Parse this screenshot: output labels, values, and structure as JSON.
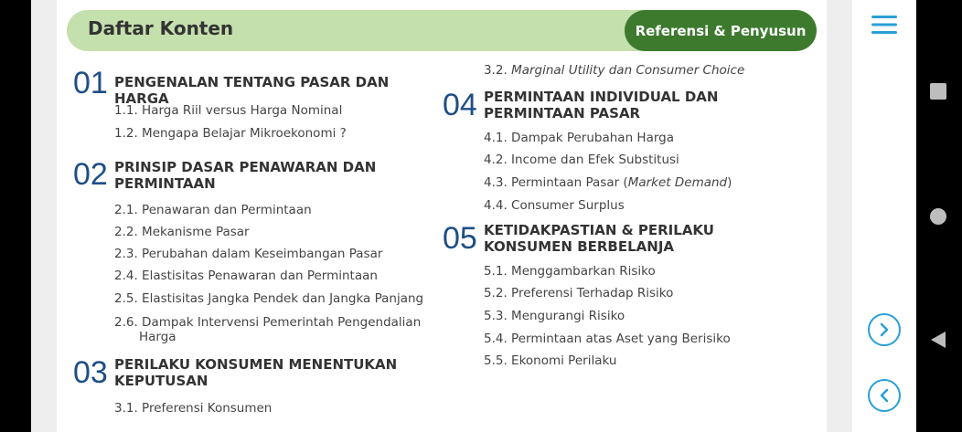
{
  "header": {
    "title": "Daftar Konten",
    "ref_button": "Referensi & Penyusun"
  },
  "chapters": [
    {
      "num": "01",
      "title": "PENGENALAN TENTANG PASAR DAN HARGA",
      "items": [
        "1.1. Harga Riil versus Harga Nominal",
        "1.2. Mengapa Belajar Mikroekonomi ?"
      ]
    },
    {
      "num": "02",
      "title": "PRINSIP DASAR PENAWARAN DAN PERMINTAAN",
      "items": [
        "2.1. Penawaran dan Permintaan",
        "2.2. Mekanisme Pasar",
        "2.3. Perubahan dalam Keseimbangan Pasar",
        "2.4. Elastisitas Penawaran dan Permintaan",
        "2.5. Elastisitas Jangka Pendek dan Jangka Panjang",
        "2.6. Dampak Intervensi Pemerintah Pengendalian Harga"
      ]
    },
    {
      "num": "03",
      "title": "PERILAKU KONSUMEN MENENTUKAN KEPUTUSAN",
      "items": [
        "3.1. Preferensi Konsumen",
        "3.2. Marginal Utility dan Consumer Choice"
      ]
    },
    {
      "num": "04",
      "title": "PERMINTAAN INDIVIDUAL DAN PERMINTAAN PASAR",
      "items": [
        "4.1. Dampak Perubahan Harga",
        "4.2. Income dan Efek Substitusi",
        "4.3. Permintaan Pasar (Market Demand)",
        "4.4. Consumer Surplus"
      ]
    },
    {
      "num": "05",
      "title": "KETIDAKPASTIAN & PERILAKU KONSUMEN BERBELANJA",
      "items": [
        "5.1. Menggambarkan Risiko",
        "5.2. Preferensi Terhadap Risiko",
        "5.3. Mengurangi Risiko",
        "5.4. Permintaan atas Aset yang Berisiko",
        "5.5. Ekonomi Perilaku"
      ]
    }
  ],
  "sub_parts": {
    "marginal_prefix": "3.2. ",
    "marginal_italic": "Marginal Utility dan Consumer Choice",
    "market_prefix": "4.3. Permintaan Pasar (",
    "market_italic": "Market Demand",
    "market_suffix": ")"
  },
  "icons": {
    "menu": "hamburger-menu-icon",
    "next": "chevron-right-icon",
    "prev": "chevron-left-icon",
    "sys_stop": "square-icon",
    "sys_home": "circle-icon",
    "sys_back": "triangle-left-icon"
  },
  "colors": {
    "accent_green": "#3d7a2e",
    "header_green": "#c3e0ad",
    "chapter_blue": "#1e4e86",
    "nav_blue": "#2a9fd6"
  }
}
